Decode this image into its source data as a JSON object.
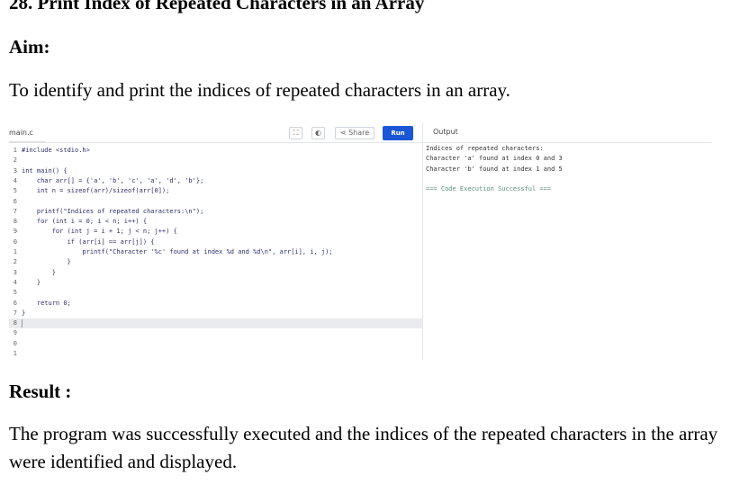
{
  "title": "28. Print Index of Repeated Characters in an Array",
  "aim": {
    "heading": "Aim:",
    "text": "To identify and print the indices of repeated characters in an array."
  },
  "ide": {
    "file_name": "main.c",
    "buttons": {
      "expand_icon": "⛶",
      "theme_icon": "◐",
      "share_label": "Share",
      "share_icon": "share-icon",
      "run_label": "Run"
    },
    "output_label": "Output",
    "code_lines": [
      {
        "n": "1",
        "fold": "",
        "text": "#include <stdio.h>"
      },
      {
        "n": "2",
        "fold": "",
        "text": ""
      },
      {
        "n": "3",
        "fold": "-",
        "text": "int main() {"
      },
      {
        "n": "4",
        "fold": "",
        "text": "    char arr[] = {'a', 'b', 'c', 'a', 'd', 'b'};"
      },
      {
        "n": "5",
        "fold": "",
        "text": "    int n = sizeof(arr)/sizeof(arr[0]);"
      },
      {
        "n": "6",
        "fold": "",
        "text": ""
      },
      {
        "n": "7",
        "fold": "",
        "text": "    printf(\"Indices of repeated characters:\\n\");"
      },
      {
        "n": "8",
        "fold": "-",
        "text": "    for (int i = 0; i < n; i++) {"
      },
      {
        "n": "9",
        "fold": "-",
        "text": "        for (int j = i + 1; j < n; j++) {"
      },
      {
        "n": "0",
        "fold": "-",
        "text": "            if (arr[i] == arr[j]) {"
      },
      {
        "n": "1",
        "fold": "",
        "text": "                printf(\"Character '%c' found at index %d and %d\\n\", arr[i], i, j);"
      },
      {
        "n": "2",
        "fold": "",
        "text": "            }"
      },
      {
        "n": "3",
        "fold": "",
        "text": "        }"
      },
      {
        "n": "4",
        "fold": "",
        "text": "    }"
      },
      {
        "n": "5",
        "fold": "",
        "text": ""
      },
      {
        "n": "6",
        "fold": "",
        "text": "    return 0;"
      },
      {
        "n": "7",
        "fold": "",
        "text": "}"
      },
      {
        "n": "8",
        "fold": "",
        "text": ""
      },
      {
        "n": "9",
        "fold": "",
        "text": ""
      },
      {
        "n": "0",
        "fold": "",
        "text": ""
      },
      {
        "n": "1",
        "fold": "",
        "text": ""
      }
    ],
    "active_line": 17,
    "output_lines": [
      {
        "text": "Indices of repeated characters:",
        "type": "normal"
      },
      {
        "text": "Character 'a' found at index 0 and 3",
        "type": "normal"
      },
      {
        "text": "Character 'b' found at index 1 and 5",
        "type": "normal"
      },
      {
        "text": "",
        "type": "normal"
      },
      {
        "text": "=== Code Execution Successful ===",
        "type": "success"
      }
    ]
  },
  "result": {
    "heading": "Result :",
    "text": "The program was successfully executed and the indices of the repeated characters in the array were identified and displayed."
  }
}
